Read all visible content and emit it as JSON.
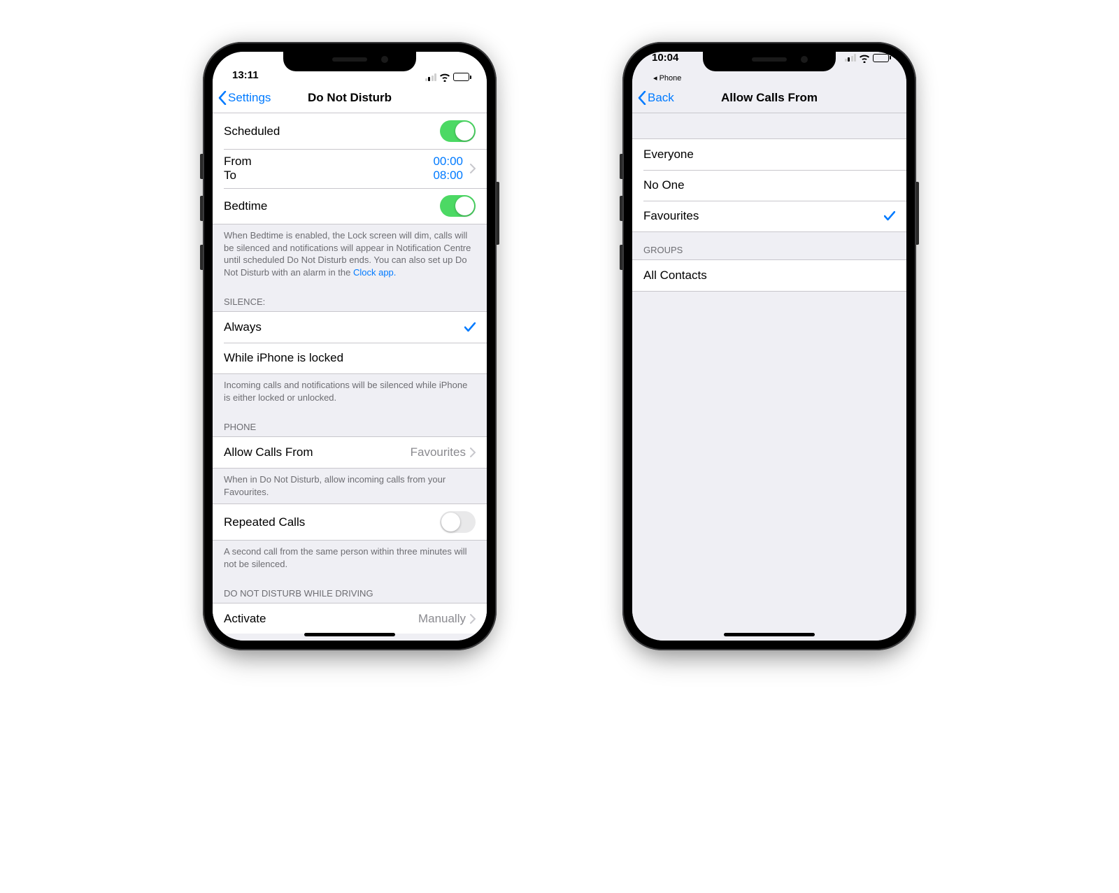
{
  "left": {
    "status": {
      "time": "13:11",
      "breadcrumb": ""
    },
    "nav": {
      "back": "Settings",
      "title": "Do Not Disturb"
    },
    "scheduled": {
      "label": "Scheduled",
      "on": true
    },
    "schedule": {
      "fromLabel": "From",
      "fromValue": "00:00",
      "toLabel": "To",
      "toValue": "08:00"
    },
    "bedtime": {
      "label": "Bedtime",
      "on": true
    },
    "bedtimeFooter": {
      "text": "When Bedtime is enabled, the Lock screen will dim, calls will be silenced and notifications will appear in Notification Centre until scheduled Do Not Disturb ends. You can also set up Do Not Disturb with an alarm in the ",
      "link": "Clock app."
    },
    "silenceHeader": "SILENCE:",
    "silence": {
      "always": "Always",
      "locked": "While iPhone is locked",
      "selected": "always"
    },
    "silenceFooter": "Incoming calls and notifications will be silenced while iPhone is either locked or unlocked.",
    "phoneHeader": "PHONE",
    "allowCalls": {
      "label": "Allow Calls From",
      "value": "Favourites"
    },
    "allowCallsFooter": "When in Do Not Disturb, allow incoming calls from your Favourites.",
    "repeated": {
      "label": "Repeated Calls",
      "on": false
    },
    "repeatedFooter": "A second call from the same person within three minutes will not be silenced.",
    "drivingHeader": "DO NOT DISTURB WHILE DRIVING",
    "activate": {
      "label": "Activate",
      "value": "Manually"
    }
  },
  "right": {
    "status": {
      "time": "10:04",
      "breadcrumb": "◂ Phone"
    },
    "nav": {
      "back": "Back",
      "title": "Allow Calls From"
    },
    "options": {
      "everyone": "Everyone",
      "noone": "No One",
      "favourites": "Favourites",
      "selected": "favourites"
    },
    "groupsHeader": "GROUPS",
    "allContacts": "All Contacts"
  }
}
